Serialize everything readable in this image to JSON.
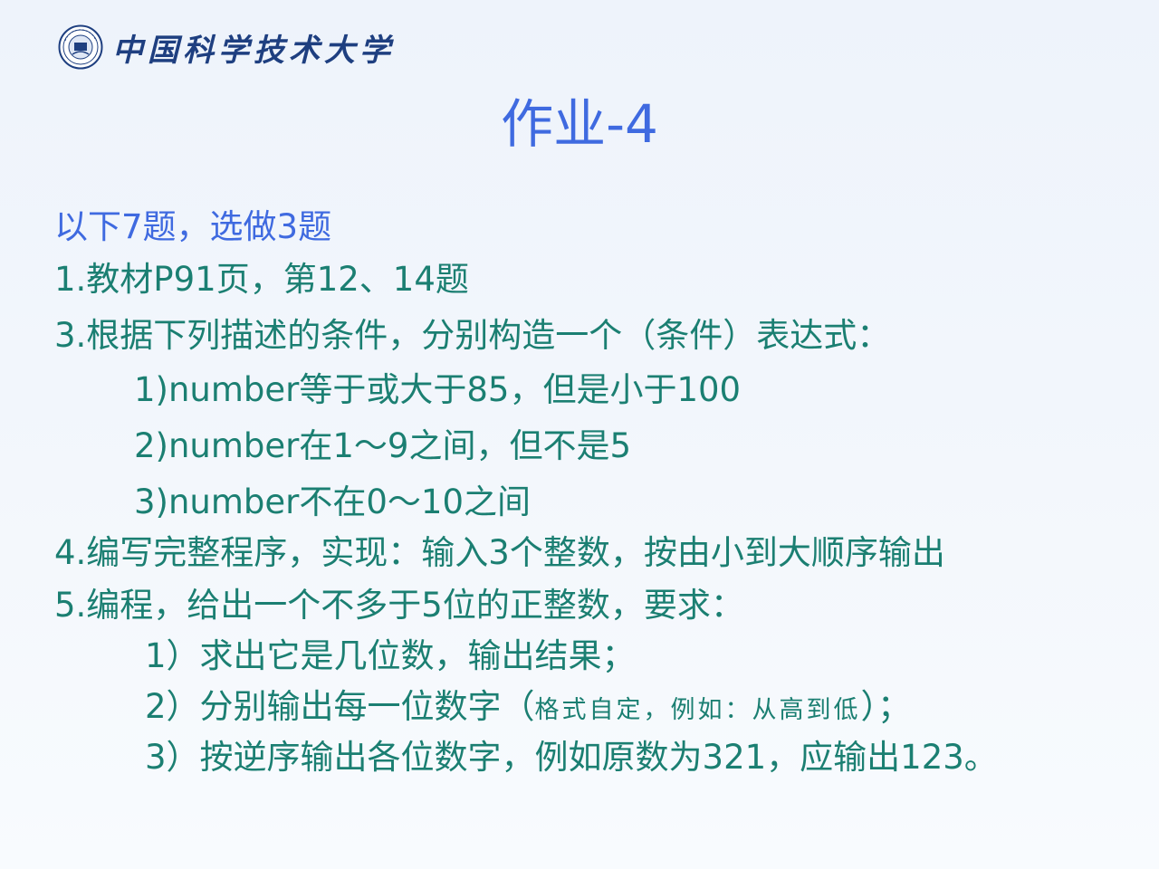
{
  "header": {
    "university_name": "中国科学技术大学"
  },
  "slide": {
    "title": "作业-4",
    "intro": "以下7题，选做3题",
    "q1": "1.教材P91页，第12、14题",
    "q3": "3.根据下列描述的条件，分别构造一个（条件）表达式：",
    "q3_items": [
      "1)number等于或大于85，但是小于100",
      "2)number在1～9之间，但不是5",
      "3)number不在0～10之间"
    ],
    "q4": "4.编写完整程序，实现：输入3个整数，按由小到大顺序输出",
    "q5": "5.编程，给出一个不多于5位的正整数，要求：",
    "q5_items": {
      "item1": "1）求出它是几位数，输出结果；",
      "item2_prefix": "2）分别输出每一位数字（",
      "item2_note": "格式自定，例如：从高到低",
      "item2_suffix": "）；",
      "item3": "3）按逆序输出各位数字，例如原数为321，应输出123。"
    }
  },
  "colors": {
    "title": "#3f6ae0",
    "body_text": "#1b7f72",
    "intro_text": "#3f6ae0",
    "logo": "#1e3f80"
  }
}
